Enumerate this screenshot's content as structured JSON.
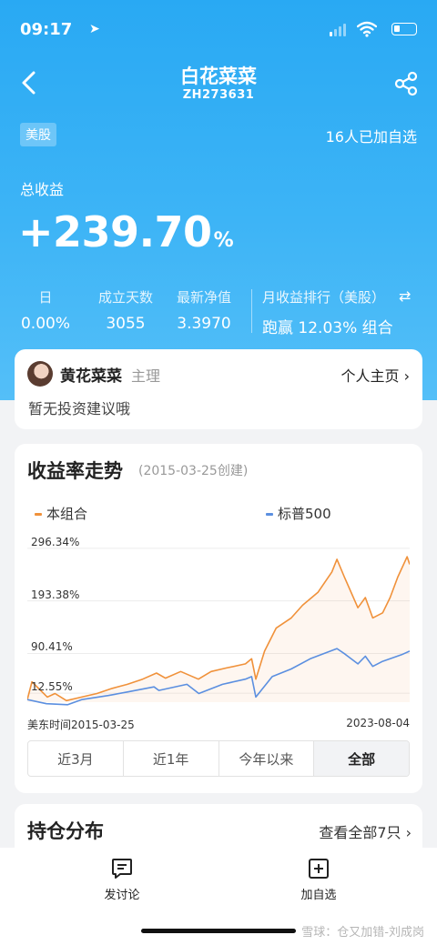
{
  "status_bar": {
    "time": "09:17",
    "location_arrow": "➤"
  },
  "nav": {
    "title": "白花菜菜",
    "subtitle": "ZH273631"
  },
  "tag": "美股",
  "followers": "16人已加自选",
  "total_return": {
    "label": "总收益",
    "value": "+239.70",
    "unit": "%"
  },
  "stats": [
    {
      "label": "日",
      "value": "0.00%"
    },
    {
      "label": "成立天数",
      "value": "3055"
    },
    {
      "label": "最新净值",
      "value": "3.3970"
    }
  ],
  "rank": {
    "label": "月收益排行（美股）",
    "swap_icon": "⇄",
    "value": "跑赢 12.03% 组合"
  },
  "manager": {
    "name": "黄花菜菜",
    "role": "主理",
    "home_link": "个人主页 ›",
    "desc": "暂无投资建议哦"
  },
  "trend": {
    "title": "收益率走势",
    "created": "(2015-03-25创建)",
    "legend": {
      "portfolio": "本组合",
      "benchmark": "标普500"
    },
    "y_labels": [
      "296.34%",
      "193.38%",
      "90.41%",
      "12.55%"
    ],
    "x_start": "美东时间2015-03-25",
    "x_end": "2023-08-04",
    "tabs": [
      "近3月",
      "近1年",
      "今年以来",
      "全部"
    ],
    "active_tab": "全部"
  },
  "holdings": {
    "title": "持仓分布",
    "all": "查看全部7只 ›"
  },
  "bottom_bar": {
    "discuss": "发讨论",
    "add_watch": "加自选"
  },
  "watermark": "雪球：仓又加错-刘成岗",
  "colors": {
    "portfolio": "#f0913a",
    "benchmark": "#5b8fe0",
    "header": "#2fadf4"
  },
  "chart_data": {
    "type": "line",
    "title": "收益率走势",
    "x_range": [
      "2015-03-25",
      "2023-08-04"
    ],
    "yticks": [
      12.55,
      90.41,
      193.38,
      296.34
    ],
    "y_unit": "%",
    "ylim": [
      -5,
      330
    ],
    "series": [
      {
        "name": "本组合",
        "color": "#f0913a",
        "points": [
          [
            "2015-03-25",
            0
          ],
          [
            "2015-05-01",
            35
          ],
          [
            "2015-07-01",
            20
          ],
          [
            "2015-09-01",
            5
          ],
          [
            "2015-11-01",
            12
          ],
          [
            "2016-02-01",
            -2
          ],
          [
            "2016-06-01",
            5
          ],
          [
            "2016-10-01",
            12
          ],
          [
            "2017-02-01",
            22
          ],
          [
            "2017-06-01",
            30
          ],
          [
            "2017-10-01",
            40
          ],
          [
            "2018-01-20",
            52
          ],
          [
            "2018-04-01",
            42
          ],
          [
            "2018-08-01",
            55
          ],
          [
            "2018-12-20",
            40
          ],
          [
            "2019-04-01",
            55
          ],
          [
            "2019-08-01",
            62
          ],
          [
            "2019-12-31",
            70
          ],
          [
            "2020-02-19",
            80
          ],
          [
            "2020-03-23",
            40
          ],
          [
            "2020-06-01",
            95
          ],
          [
            "2020-09-01",
            140
          ],
          [
            "2020-12-31",
            160
          ],
          [
            "2021-04-01",
            185
          ],
          [
            "2021-08-01",
            210
          ],
          [
            "2021-11-20",
            250
          ],
          [
            "2021-12-31",
            275
          ],
          [
            "2022-03-01",
            240
          ],
          [
            "2022-06-16",
            180
          ],
          [
            "2022-08-15",
            200
          ],
          [
            "2022-10-13",
            160
          ],
          [
            "2022-12-31",
            170
          ],
          [
            "2023-03-01",
            200
          ],
          [
            "2023-05-01",
            240
          ],
          [
            "2023-07-15",
            280
          ],
          [
            "2023-08-04",
            265
          ]
        ]
      },
      {
        "name": "标普500",
        "color": "#5b8fe0",
        "points": [
          [
            "2015-03-25",
            0
          ],
          [
            "2015-08-25",
            -8
          ],
          [
            "2016-02-11",
            -10
          ],
          [
            "2016-06-01",
            0
          ],
          [
            "2016-12-31",
            8
          ],
          [
            "2017-06-01",
            15
          ],
          [
            "2017-12-31",
            25
          ],
          [
            "2018-02-08",
            18
          ],
          [
            "2018-09-20",
            30
          ],
          [
            "2018-12-24",
            12
          ],
          [
            "2019-07-01",
            30
          ],
          [
            "2019-12-31",
            40
          ],
          [
            "2020-02-19",
            45
          ],
          [
            "2020-03-23",
            5
          ],
          [
            "2020-08-01",
            45
          ],
          [
            "2020-12-31",
            60
          ],
          [
            "2021-06-01",
            80
          ],
          [
            "2021-12-31",
            100
          ],
          [
            "2022-03-01",
            90
          ],
          [
            "2022-06-16",
            70
          ],
          [
            "2022-08-15",
            85
          ],
          [
            "2022-10-13",
            65
          ],
          [
            "2022-12-31",
            75
          ],
          [
            "2023-03-01",
            80
          ],
          [
            "2023-06-01",
            88
          ],
          [
            "2023-08-04",
            95
          ]
        ]
      }
    ]
  }
}
